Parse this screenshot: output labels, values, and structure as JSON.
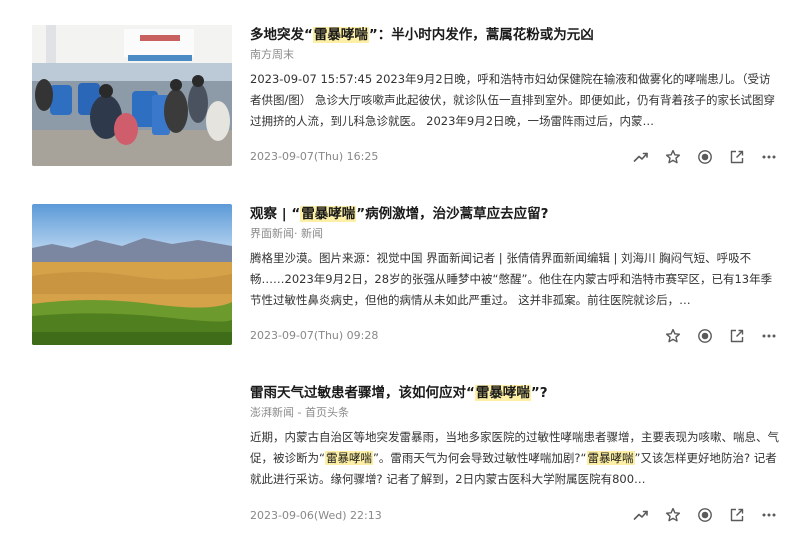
{
  "articles": [
    {
      "title_before": "多地突发“",
      "title_highlight": "雷暴哮喘",
      "title_after": "”：半小时内发作，蒿属花粉或为元凶",
      "source": "南方周末",
      "snippet_parts": [
        {
          "text": "2023-09-07 15:57:45 2023年9月2日晚，呼和浩特市妇幼保健院在输液和做雾化的哮喘患儿。（受访者供图/图） 急诊大厅咳嗽声此起彼伏，就诊队伍一直排到室外。即便如此，仍有背着孩子的家长试图穿过拥挤的人流，到儿科急诊就医。 2023年9月2日晚，一场雷阵雨过后，内蒙…",
          "hl": false
        }
      ],
      "date": "2023-09-07(Thu) 16:25",
      "actions": [
        "trend-icon",
        "star-icon",
        "radio-icon",
        "open-external-icon",
        "more-icon"
      ]
    },
    {
      "title_before": "观察 | “",
      "title_highlight": "雷暴哮喘",
      "title_after": "”病例激增，治沙蒿草应去应留?",
      "source": "界面新闻· 新闻",
      "snippet_parts": [
        {
          "text": "腾格里沙漠。图片来源：视觉中国 界面新闻记者 | 张倩倩界面新闻编辑 | 刘海川 胸闷气短、呼吸不畅……2023年9月2日，28岁的张强从睡梦中被“憋醒”。他住在内蒙古呼和浩特市赛罕区，已有13年季节性过敏性鼻炎病史，但他的病情从未如此严重过。 这并非孤案。前往医院就诊后，…",
          "hl": false
        }
      ],
      "date": "2023-09-07(Thu) 09:28",
      "actions": [
        "star-icon",
        "radio-icon",
        "open-external-icon",
        "more-icon"
      ]
    },
    {
      "title_before": "雷雨天气过敏患者骤增，该如何应对“",
      "title_highlight": "雷暴哮喘",
      "title_after": "”?",
      "source": "澎湃新闻 - 首页头条",
      "snippet_parts": [
        {
          "text": "近期，内蒙古自治区等地突发雷暴雨，当地多家医院的过敏性哮喘患者骤增，主要表现为咳嗽、喘息、气促，被诊断为“",
          "hl": false
        },
        {
          "text": "雷暴哮喘",
          "hl": true
        },
        {
          "text": "”。雷雨天气为何会导致过敏性哮喘加剧?“",
          "hl": false
        },
        {
          "text": "雷暴哮喘",
          "hl": true
        },
        {
          "text": "”又该怎样更好地防治? 记者就此进行采访。缘何骤增? 记者了解到，2日内蒙古医科大学附属医院有800…",
          "hl": false
        }
      ],
      "date": "2023-09-06(Wed) 22:13",
      "actions": [
        "trend-icon",
        "star-icon",
        "radio-icon",
        "open-external-icon",
        "more-icon"
      ]
    }
  ],
  "colors": {
    "highlight": "#fdf0a6",
    "icon": "#5a5a5a"
  }
}
